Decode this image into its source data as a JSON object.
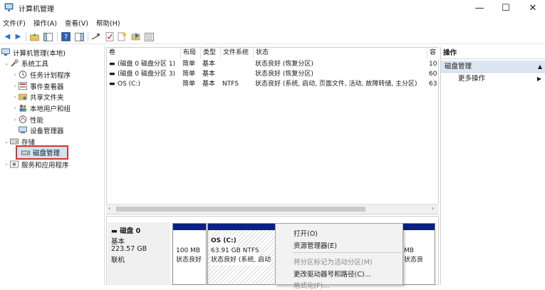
{
  "window": {
    "title": "计算机管理",
    "minimize": "—",
    "maximize": "☐",
    "close": "✕"
  },
  "menu": [
    "文件(F)",
    "操作(A)",
    "查看(V)",
    "帮助(H)"
  ],
  "tree": {
    "root": "计算机管理(本地)",
    "system_tools": "系统工具",
    "task_scheduler": "任务计划程序",
    "event_viewer": "事件查看器",
    "shared_folders": "共享文件夹",
    "local_users": "本地用户和组",
    "performance": "性能",
    "device_manager": "设备管理器",
    "storage": "存储",
    "disk_management": "磁盘管理",
    "services_apps": "服务和应用程序"
  },
  "volumes": {
    "columns": [
      "卷",
      "布局",
      "类型",
      "文件系统",
      "状态",
      "容"
    ],
    "rows": [
      {
        "name": "(磁盘 0 磁盘分区 1)",
        "layout": "简单",
        "type": "基本",
        "fs": "",
        "status": "状态良好 (恢复分区)",
        "cap": "10"
      },
      {
        "name": "(磁盘 0 磁盘分区 3)",
        "layout": "简单",
        "type": "基本",
        "fs": "",
        "status": "状态良好 (恢复分区)",
        "cap": "60"
      },
      {
        "name": "OS (C:)",
        "layout": "简单",
        "type": "基本",
        "fs": "NTFS",
        "status": "状态良好 (系统, 启动, 页面文件, 活动, 故障转储, 主分区)",
        "cap": "63"
      }
    ]
  },
  "disk0": {
    "name": "磁盘 0",
    "type": "基本",
    "size": "223.57 GB",
    "status": "联机",
    "p1_size": "100 MB",
    "p1_status": "状态良好",
    "os_name": "OS  (C:)",
    "os_size": "63.91 GB NTFS",
    "os_status": "状态良好 (系统, 启动",
    "last_size": "MB",
    "last_status": "状态良"
  },
  "context_menu": {
    "open": "打开(O)",
    "explore": "资源管理器(E)",
    "mark_active": "将分区标记为活动分区(M)",
    "change_letter": "更改驱动器号和路径(C)...",
    "format": "格式化(F)..."
  },
  "actions": {
    "header": "操作",
    "section": "磁盘管理",
    "more": "更多操作"
  },
  "colors": {
    "partition_bar": "#0b1f87",
    "selection_outline": "#d9342b",
    "actions_section_bg": "#dce6f2"
  }
}
